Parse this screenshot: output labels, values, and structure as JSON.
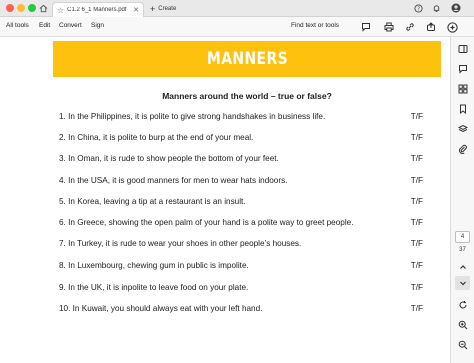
{
  "window": {
    "tab_title": "C1.2 6_1 Manners.pdf",
    "create_label": "Create"
  },
  "toolbar": {
    "all_tools": "All tools",
    "edit": "Edit",
    "convert": "Convert",
    "sign": "Sign",
    "find_label": "Find text or tools"
  },
  "document": {
    "banner_title": "MANNERS",
    "subtitle": "Manners around the world – true or false?",
    "answer_label": "T/F",
    "questions": [
      "1. In the Philippines, it is polite to give strong handshakes in business life.",
      "2. In China, it is polite to burp at the end of your meal.",
      "3. In Oman, it is rude to show people the bottom of your feet.",
      "4. In the USA, it is good manners for men to wear hats indoors.",
      "5. In Korea, leaving a tip at a restaurant is an insult.",
      "6. In Greece, showing the open palm of your hand is a polite way to greet people.",
      "7. In Turkey, it is rude to wear your shoes in other people’s houses.",
      "8. In Luxembourg, chewing gum in public is impolite.",
      "9. In the UK, it is inpolite to leave food on your plate.",
      "10. In Kuwait, you should always eat with your left hand."
    ]
  },
  "pagination": {
    "current_page": "4",
    "total_pages": "37"
  },
  "colors": {
    "banner": "#fec20e",
    "banner_text": "#ffffff"
  },
  "icons": {
    "titlebar": [
      "home-icon",
      "star-icon",
      "close-icon",
      "plus-icon",
      "help-icon",
      "bell-icon",
      "avatar-icon"
    ],
    "toolbar": [
      "comment-icon",
      "print-icon",
      "link-icon",
      "share-icon",
      "ai-assistant-icon"
    ],
    "rail": [
      "panel-toggle-icon",
      "comments-icon",
      "thumbnails-icon",
      "bookmarks-icon",
      "layers-icon",
      "attachments-icon",
      "chevron-up-icon",
      "chevron-down-icon",
      "rotate-icon",
      "zoom-in-icon",
      "zoom-out-icon"
    ]
  }
}
